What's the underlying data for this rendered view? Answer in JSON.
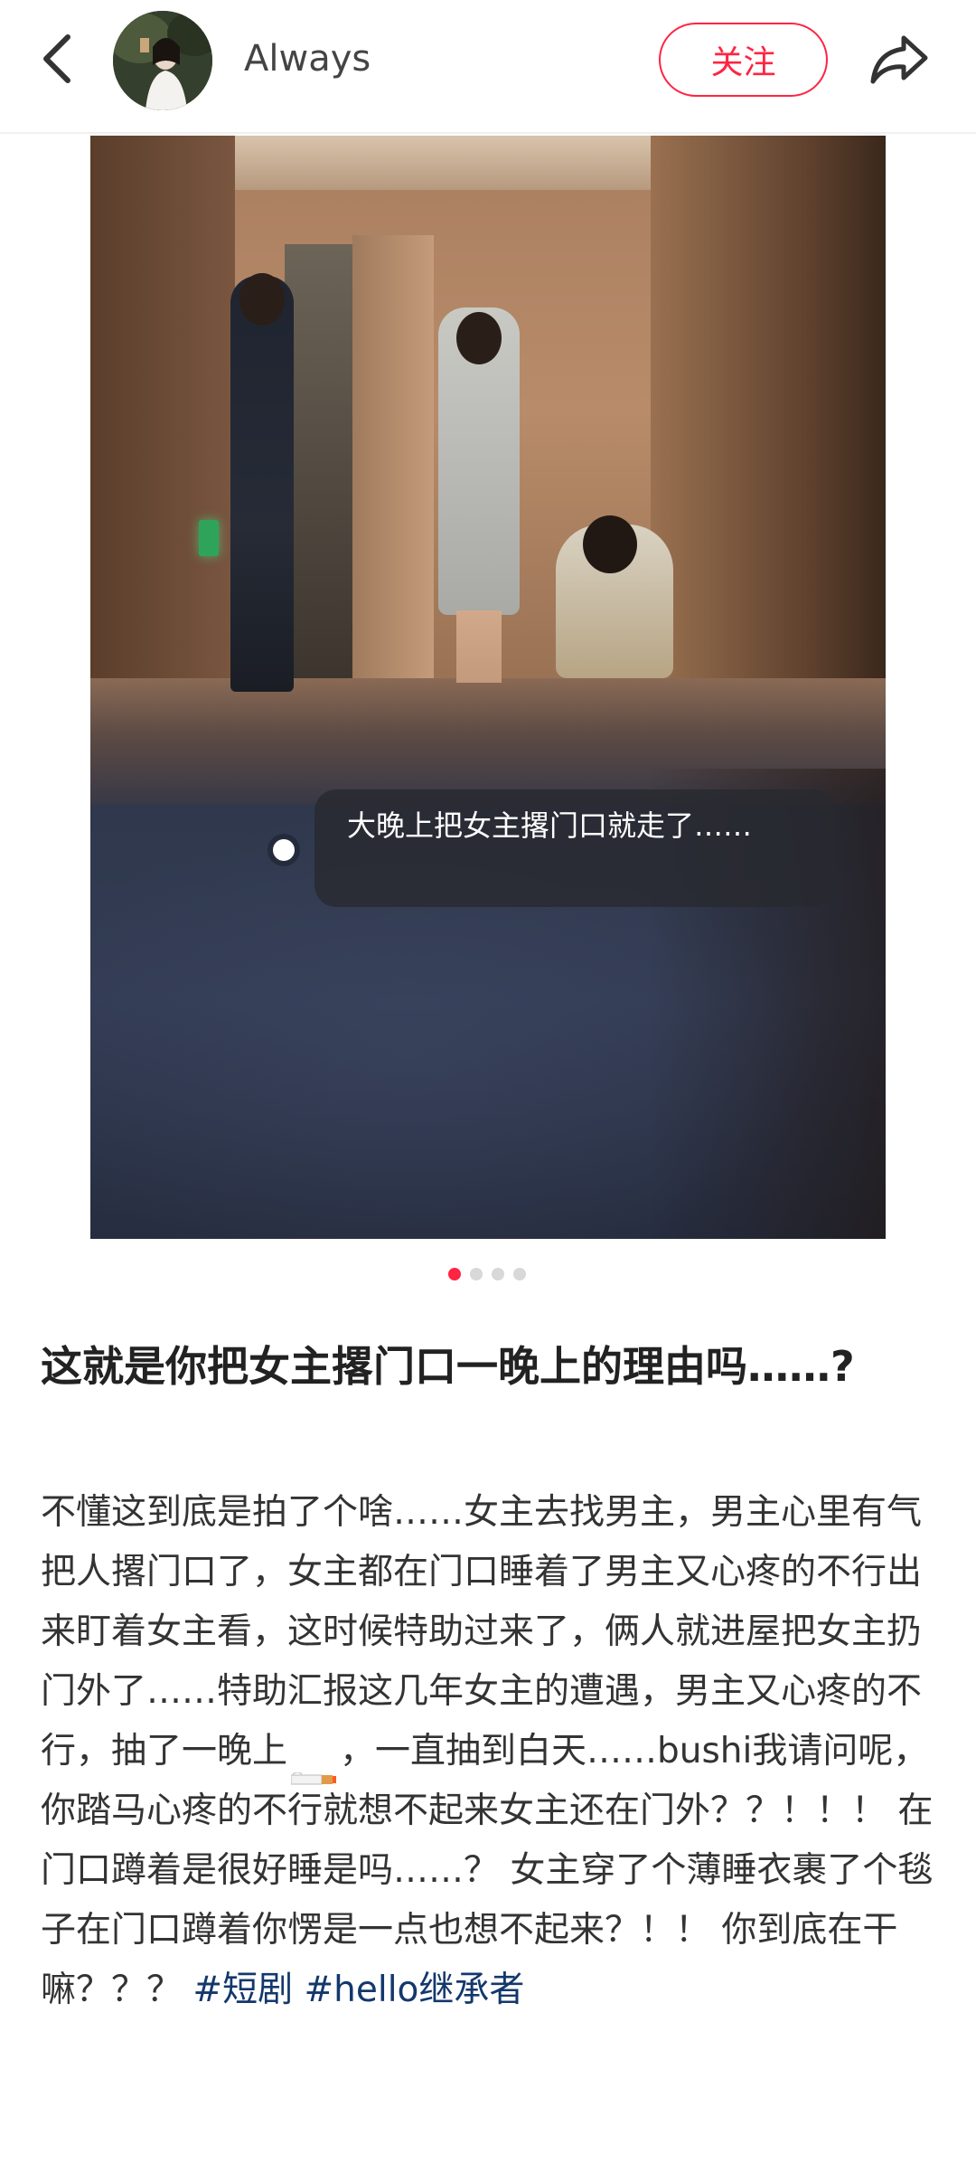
{
  "header": {
    "username": "Always",
    "follow_label": "关注",
    "back_icon": "chevron-left-icon",
    "share_icon": "share-arrow-icon"
  },
  "media": {
    "caption": "大晚上把女主撂门口就走了……",
    "carousel": {
      "total": 4,
      "active_index": 0
    }
  },
  "post": {
    "title": "这就是你把女主撂门口一晚上的理由吗……?",
    "body_part1": "不懂这到底是拍了个啥……女主去找男主，男主心里有气把人撂门口了，女主都在门口睡着了男主又心疼的不行出来盯着女主看，这时候特助过来了，俩人就进屋把女主扔门外了……特助汇报这几年女主的遭遇，男主又心疼的不行，抽了一晚上",
    "emoji": "cigarette-icon",
    "body_part2": "，一直抽到白天……bushi我请问呢，你踏马心疼的不行就想不起来女主还在门外？？！！！ 在门口蹲着是很好睡是吗……？ 女主穿了个薄睡衣裹了个毯子在门口蹲着你愣是一点也想不起来？！！ 你到底在干嘛？？？ ",
    "hashtags": [
      "#短剧",
      "#hello继承者"
    ]
  },
  "colors": {
    "accent": "#ff2442",
    "hashtag": "#13386c",
    "text": "#333333"
  }
}
